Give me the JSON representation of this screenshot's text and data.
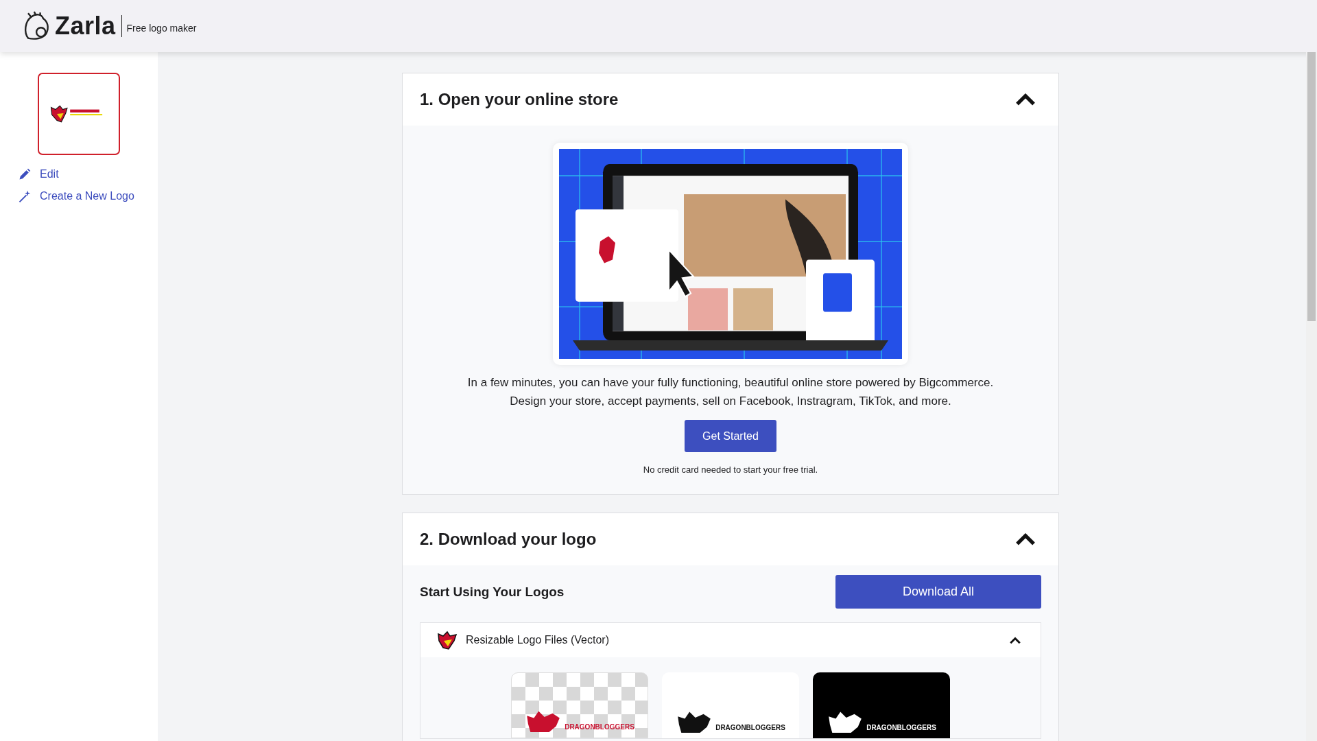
{
  "header": {
    "brand": "Zarla",
    "tagline": "Free logo maker"
  },
  "sidebar": {
    "items": [
      {
        "kind": "edit",
        "label": "Edit"
      },
      {
        "kind": "create",
        "label": "Create a New Logo"
      }
    ]
  },
  "sections": [
    {
      "title": "1. Open your online store",
      "expanded": true,
      "kind": "store",
      "lines": [
        "In a few minutes, you can have your fully functioning, beautiful online store powered by Bigcommerce.",
        "Design your store, accept payments, sell on Facebook, Instragram, TikTok, and more."
      ],
      "button": "Get Started",
      "note": "No credit card needed to start your free trial."
    },
    {
      "title": "2. Download your logo",
      "expanded": true,
      "kind": "download",
      "heading": "Start Using Your Logos",
      "button": "Download All",
      "panel": {
        "title": "Resizable Logo Files (Vector)",
        "expanded": true,
        "tiles": [
          {
            "kind": "transparent",
            "wordmark": "DRAGONBLOGGERS"
          },
          {
            "kind": "white",
            "wordmark": "DRAGONBLOGGERS"
          },
          {
            "kind": "black",
            "wordmark": "DRAGONBLOGGERS"
          }
        ]
      }
    }
  ]
}
